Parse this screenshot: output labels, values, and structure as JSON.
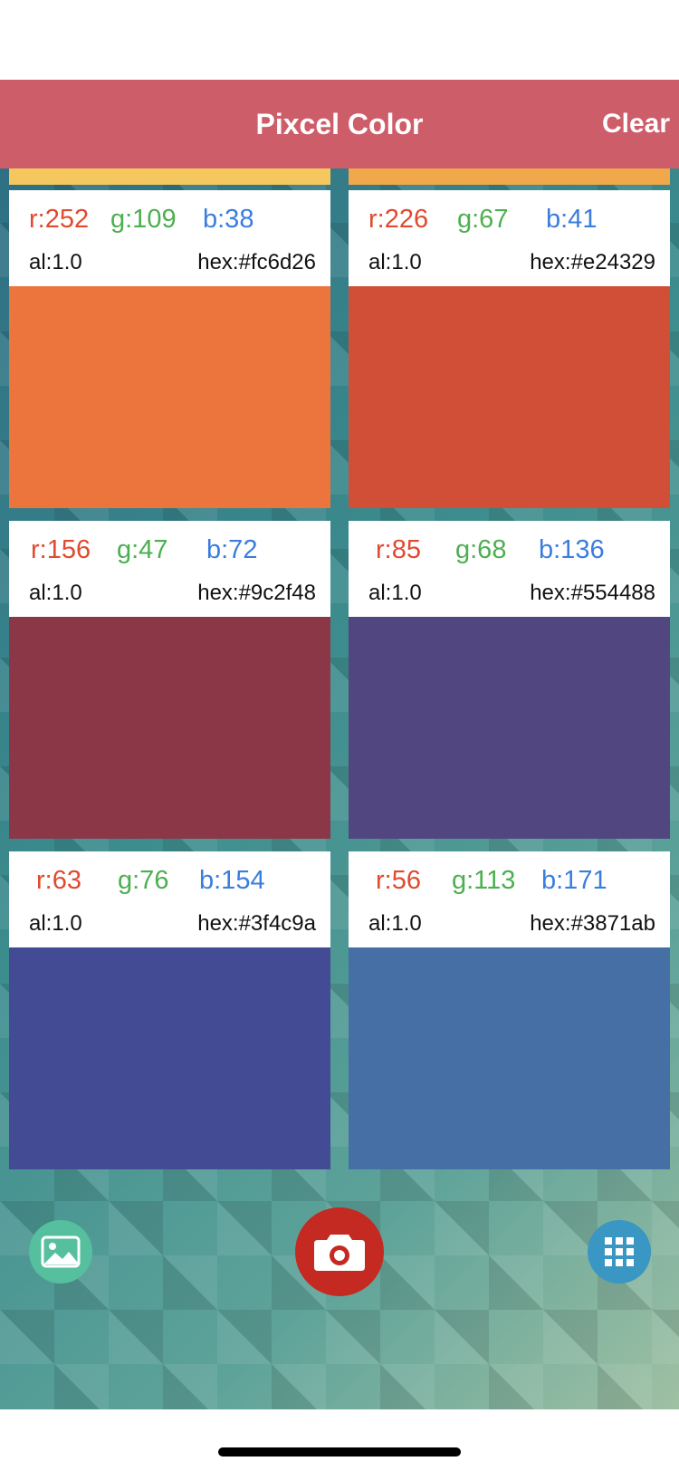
{
  "nav": {
    "title": "Pixcel Color",
    "clear_label": "Clear"
  },
  "top_strips": [
    {
      "color": "#f5c85f"
    },
    {
      "color": "#f0a84a"
    }
  ],
  "colors": [
    {
      "r": "r:252",
      "g": "g:109",
      "b": "b:38",
      "alpha": "al:1.0",
      "hex": "hex:#fc6d26",
      "swatch": "#ec743d"
    },
    {
      "r": "r:226",
      "g": "g:67",
      "b": "b:41",
      "alpha": "al:1.0",
      "hex": "hex:#e24329",
      "swatch": "#d24f37"
    },
    {
      "r": "r:156",
      "g": "g:47",
      "b": "b:72",
      "alpha": "al:1.0",
      "hex": "hex:#9c2f48",
      "swatch": "#8b3748"
    },
    {
      "r": "r:85",
      "g": "g:68",
      "b": "b:136",
      "alpha": "al:1.0",
      "hex": "hex:#554488",
      "swatch": "#524680"
    },
    {
      "r": "r:63",
      "g": "g:76",
      "b": "b:154",
      "alpha": "al:1.0",
      "hex": "hex:#3f4c9a",
      "swatch": "#424b94"
    },
    {
      "r": "r:56",
      "g": "g:113",
      "b": "b:171",
      "alpha": "al:1.0",
      "hex": "hex:#3871ab",
      "swatch": "#4670a5"
    }
  ],
  "toolbar": {
    "gallery_icon": "image-icon",
    "camera_icon": "camera-icon",
    "grid_icon": "grid-icon"
  }
}
